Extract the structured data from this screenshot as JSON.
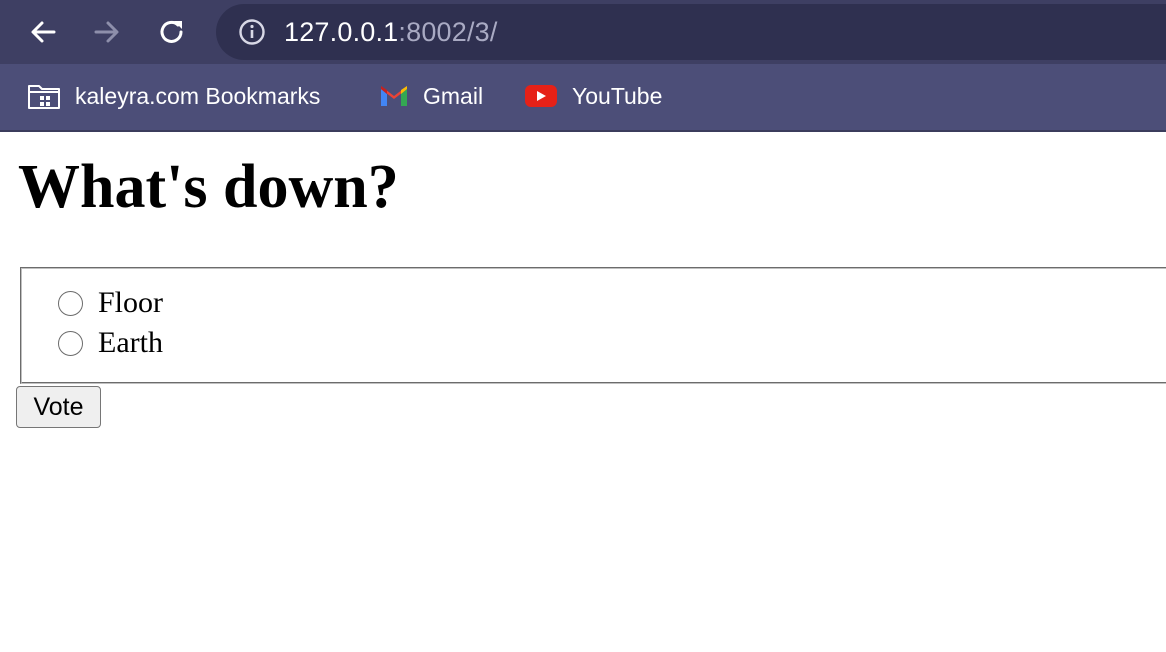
{
  "browser": {
    "url_host": "127.0.0.1",
    "url_rest": ":8002/3/",
    "bookmarks": [
      {
        "label": "kaleyra.com Bookmarks",
        "icon": "folder-icon"
      },
      {
        "label": "Gmail",
        "icon": "gmail-icon"
      },
      {
        "label": "YouTube",
        "icon": "youtube-icon"
      }
    ]
  },
  "page": {
    "heading": "What's down?",
    "choices": [
      {
        "label": "Floor",
        "checked": false
      },
      {
        "label": "Earth",
        "checked": false
      }
    ],
    "submit_label": "Vote"
  },
  "colors": {
    "toolbar": "#3e3f63",
    "bookmarks_bar": "#4c4e78",
    "omnibox": "#2f3050",
    "youtube_red": "#e62117"
  }
}
